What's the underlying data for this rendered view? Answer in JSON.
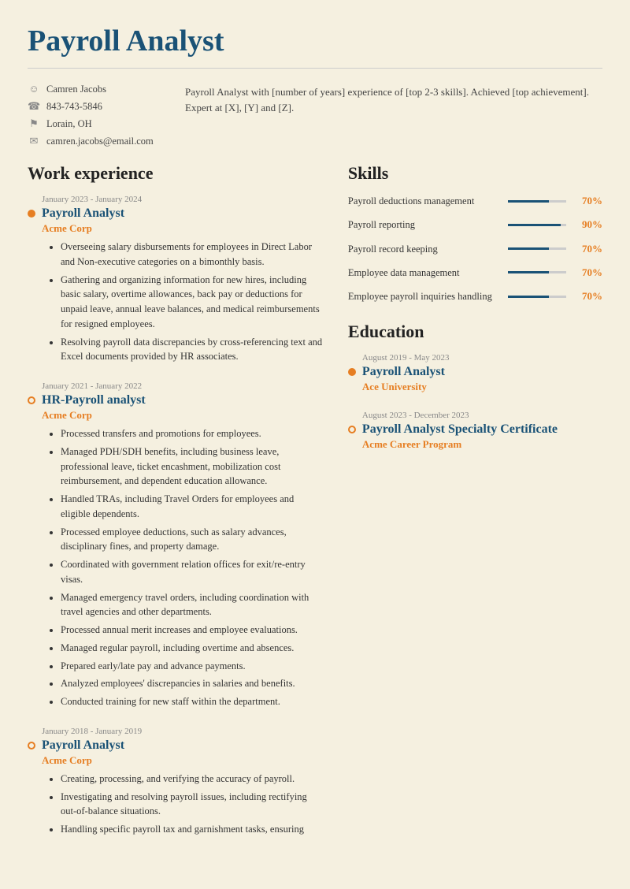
{
  "header": {
    "title": "Payroll Analyst",
    "contact": {
      "name": "Camren Jacobs",
      "phone": "843-743-5846",
      "location": "Lorain, OH",
      "email": "camren.jacobs@email.com"
    },
    "summary": "Payroll Analyst with [number of years] experience of [top 2-3 skills]. Achieved [top achievement]. Expert at [X], [Y] and [Z]."
  },
  "work_experience": {
    "section_title": "Work experience",
    "entries": [
      {
        "date": "January 2023 - January 2024",
        "title": "Payroll Analyst",
        "company": "Acme Corp",
        "filled": true,
        "bullets": [
          "Overseeing salary disbursements for employees in Direct Labor and Non-executive categories on a bimonthly basis.",
          "Gathering and organizing information for new hires, including basic salary, overtime allowances, back pay or deductions for unpaid leave, annual leave balances, and medical reimbursements for resigned employees.",
          "Resolving payroll data discrepancies by cross-referencing text and Excel documents provided by HR associates."
        ]
      },
      {
        "date": "January 2021 - January 2022",
        "title": "HR-Payroll analyst",
        "company": "Acme Corp",
        "filled": false,
        "bullets": [
          "Processed transfers and promotions for employees.",
          "Managed PDH/SDH benefits, including business leave, professional leave, ticket encashment, mobilization cost reimbursement, and dependent education allowance.",
          "Handled TRAs, including Travel Orders for employees and eligible dependents.",
          "Processed employee deductions, such as salary advances, disciplinary fines, and property damage.",
          "Coordinated with government relation offices for exit/re-entry visas.",
          "Managed emergency travel orders, including coordination with travel agencies and other departments.",
          "Processed annual merit increases and employee evaluations.",
          "Managed regular payroll, including overtime and absences.",
          "Prepared early/late pay and advance payments.",
          "Analyzed employees' discrepancies in salaries and benefits.",
          "Conducted training for new staff within the department."
        ]
      },
      {
        "date": "January 2018 - January 2019",
        "title": "Payroll Analyst",
        "company": "Acme Corp",
        "filled": false,
        "bullets": [
          "Creating, processing, and verifying the accuracy of payroll.",
          "Investigating and resolving payroll issues, including rectifying out-of-balance situations.",
          "Handling specific payroll tax and garnishment tasks, ensuring"
        ]
      }
    ]
  },
  "skills": {
    "section_title": "Skills",
    "items": [
      {
        "label": "Payroll deductions management",
        "pct": 70
      },
      {
        "label": "Payroll reporting",
        "pct": 90
      },
      {
        "label": "Payroll record keeping",
        "pct": 70
      },
      {
        "label": "Employee data management",
        "pct": 70
      },
      {
        "label": "Employee payroll inquiries handling",
        "pct": 70
      }
    ]
  },
  "education": {
    "section_title": "Education",
    "entries": [
      {
        "date": "August 2019 - May 2023",
        "title": "Payroll Analyst",
        "institution": "Ace University",
        "filled": true
      },
      {
        "date": "August 2023 - December 2023",
        "title": "Payroll Analyst Specialty Certificate",
        "institution": "Acme Career Program",
        "filled": false
      }
    ]
  }
}
